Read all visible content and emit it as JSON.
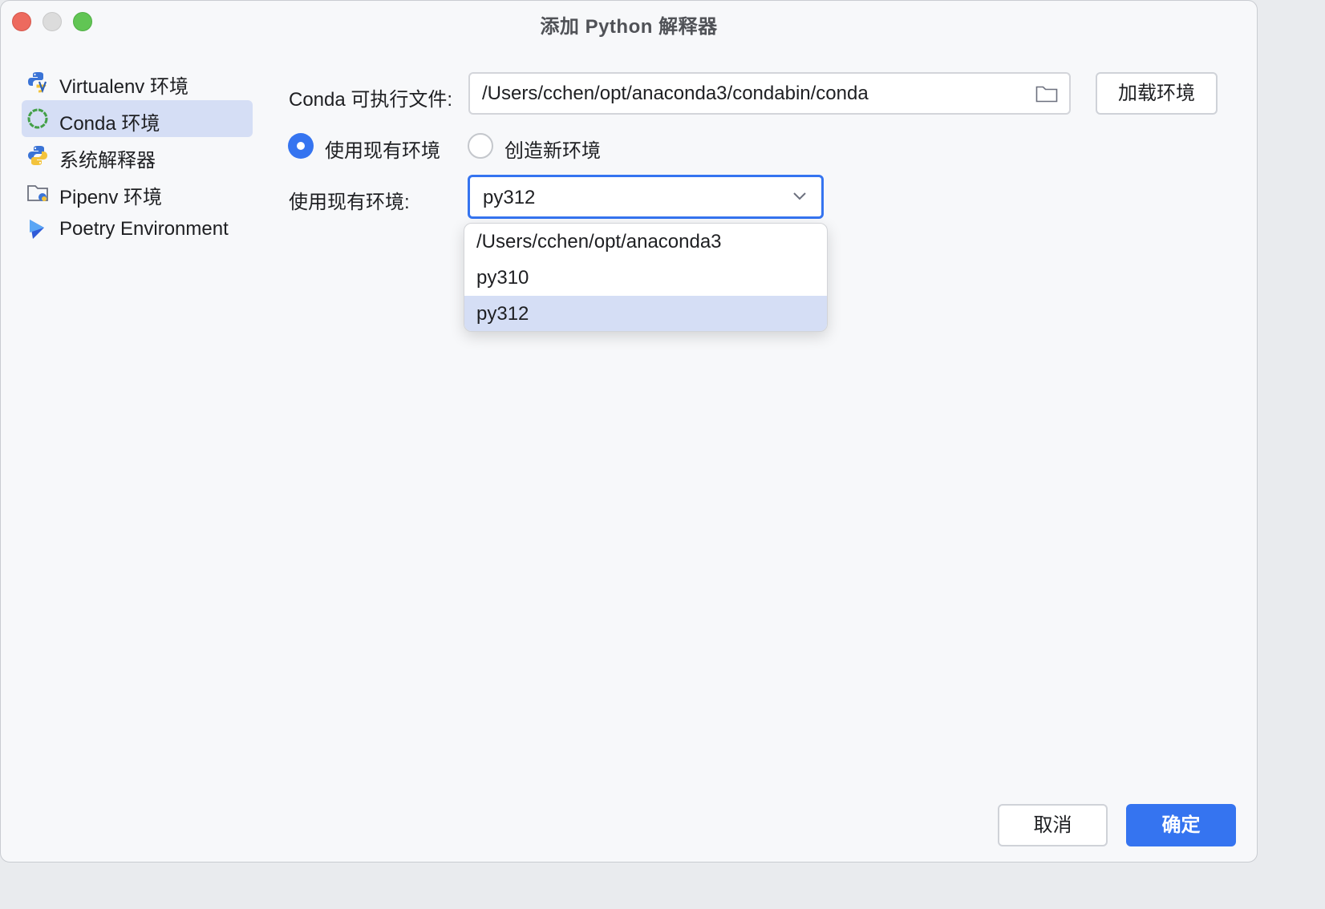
{
  "window": {
    "title": "添加 Python 解释器"
  },
  "sidebar": {
    "items": [
      {
        "label": "Virtualenv 环境",
        "icon": "virtualenv-icon"
      },
      {
        "label": "Conda 环境",
        "icon": "conda-icon",
        "selected": true
      },
      {
        "label": "系统解释器",
        "icon": "python-icon"
      },
      {
        "label": "Pipenv 环境",
        "icon": "pipenv-folder-icon"
      },
      {
        "label": "Poetry Environment",
        "icon": "poetry-icon"
      }
    ]
  },
  "main": {
    "conda_exec_label": "Conda 可执行文件:",
    "conda_exec_value": "/Users/cchen/opt/anaconda3/condabin/conda",
    "load_env_button": "加载环境",
    "radio_existing": "使用现有环境",
    "radio_new": "创造新环境",
    "existing_env_label": "使用现有环境:",
    "existing_env_value": "py312",
    "dropdown_options": [
      "/Users/cchen/opt/anaconda3",
      "py310",
      "py312"
    ],
    "dropdown_selected_index": 2
  },
  "footer": {
    "cancel": "取消",
    "ok": "确定"
  },
  "colors": {
    "accent": "#3574f0",
    "selection": "#d5def5",
    "background": "#f7f8fa"
  }
}
